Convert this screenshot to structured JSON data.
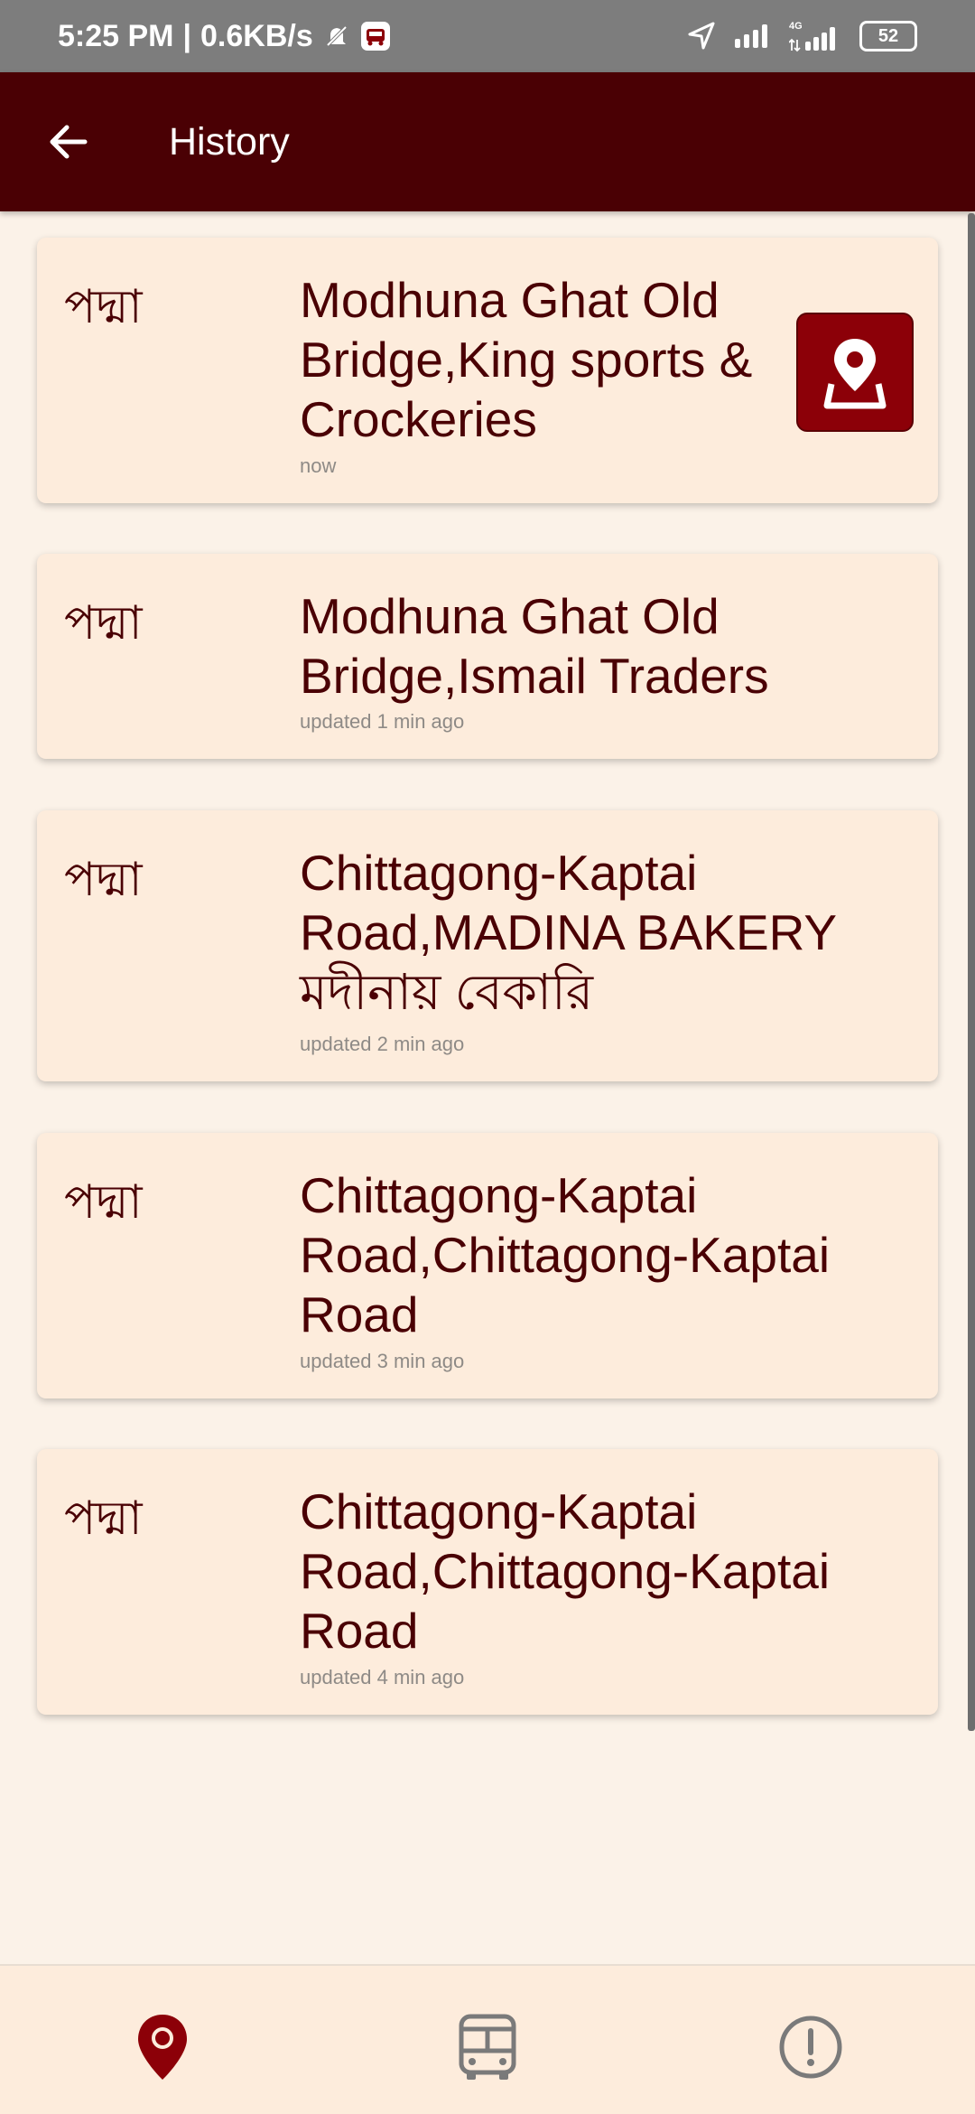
{
  "status_bar": {
    "time": "5:25 PM",
    "separator": "|",
    "speed": "0.6KB/s",
    "network_label": "4G",
    "battery": "52"
  },
  "app_bar": {
    "title": "History",
    "back_icon": "arrow-left-icon"
  },
  "history": [
    {
      "route": "পদ্মা",
      "place": "Modhuna Ghat Old Bridge,King sports & Crockeries",
      "time": "now",
      "has_map_button": true
    },
    {
      "route": "পদ্মা",
      "place": "Modhuna Ghat Old Bridge,Ismail Traders",
      "time": "updated 1 min ago"
    },
    {
      "route": "পদ্মা",
      "place": "Chittagong-Kaptai Road,MADINA BAKERY মদীনায় বেকারি",
      "time": "updated 2 min ago"
    },
    {
      "route": "পদ্মা",
      "place": "Chittagong-Kaptai Road,Chittagong-Kaptai Road",
      "time": "updated 3 min ago"
    },
    {
      "route": "পদ্মা",
      "place": "Chittagong-Kaptai Road,Chittagong-Kaptai Road",
      "time": "updated 4 min ago"
    }
  ],
  "bottom_nav": {
    "items": [
      {
        "icon": "location-pin-icon",
        "active": true
      },
      {
        "icon": "bus-icon",
        "active": false
      },
      {
        "icon": "alert-circle-icon",
        "active": false
      }
    ]
  },
  "colors": {
    "primary": "#4a0004",
    "accent": "#8c0008",
    "card": "#fdecdc",
    "background": "#fbf2e8",
    "inactive_icon": "#7a7a7a"
  }
}
